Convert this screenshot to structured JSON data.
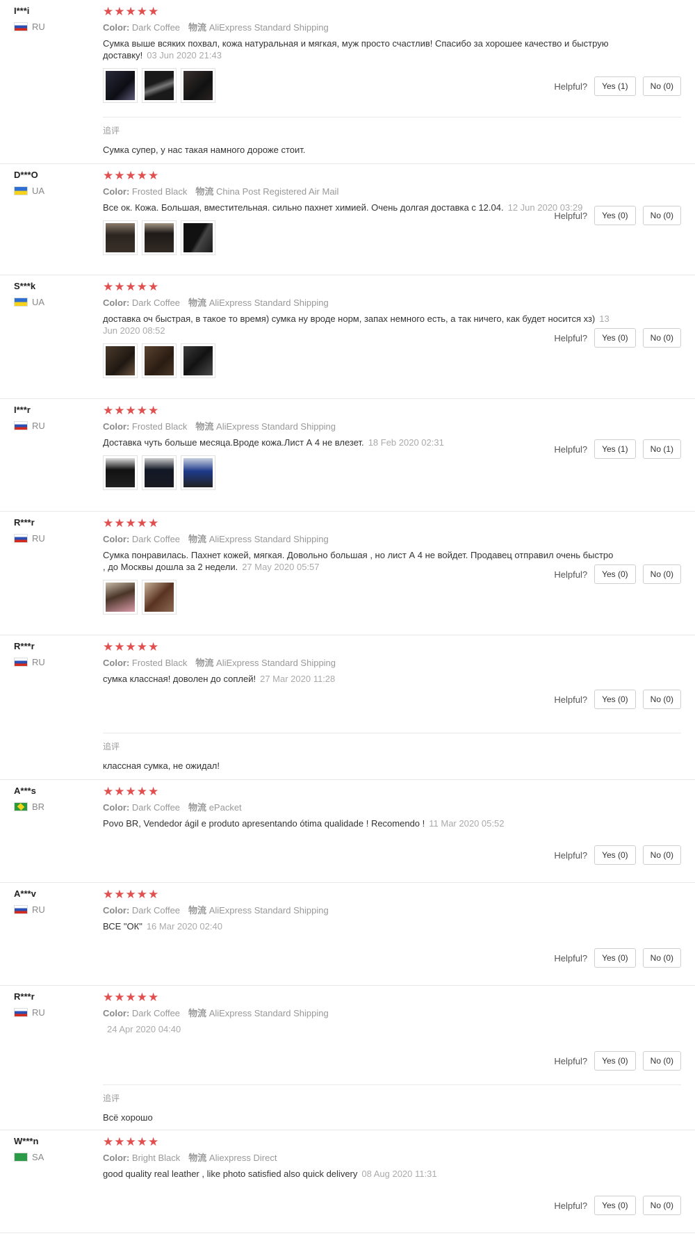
{
  "star_glyphs": "★★★★★",
  "color_label": "Color:",
  "shipping_label": "物流",
  "helpful_label": "Helpful?",
  "additional_label": "追评",
  "star_color": "#e24f4f",
  "reviews": [
    {
      "user": "I***i",
      "country": "RU",
      "rating": 5,
      "color": "Dark Coffee",
      "shipping": "AliExpress Standard Shipping",
      "text": "Сумка выше всяких похвал, кожа натуральная и мягкая, муж просто счастлив! Спасибо за хорошее качество и быструю доставку!",
      "date": "03 Jun 2020 21:43",
      "photos": 3,
      "yes": "Yes (1)",
      "no": "No (0)",
      "additional": "Сумка супер, у нас такая намного дороже стоит."
    },
    {
      "user": "D***O",
      "country": "UA",
      "rating": 5,
      "color": "Frosted Black",
      "shipping": "China Post Registered Air Mail",
      "text": "Все ок. Кожа. Большая, вместительная. сильно пахнет химией. Очень долгая доставка с 12.04.",
      "date": "12 Jun 2020 03:29",
      "photos": 3,
      "yes": "Yes (0)",
      "no": "No (0)"
    },
    {
      "user": "S***k",
      "country": "UA",
      "rating": 5,
      "color": "Dark Coffee",
      "shipping": "AliExpress Standard Shipping",
      "text": "доставка оч быстрая, в такое то время) сумка ну вроде норм, запах немного есть, а так ничего, как будет носится хз)",
      "date": "13 Jun 2020 08:52",
      "photos": 3,
      "yes": "Yes (0)",
      "no": "No (0)"
    },
    {
      "user": "I***r",
      "country": "RU",
      "rating": 5,
      "color": "Frosted Black",
      "shipping": "AliExpress Standard Shipping",
      "text": "Доставка чуть больше месяца.Вроде кожа.Лист А 4 не влезет.",
      "date": "18 Feb 2020 02:31",
      "photos": 3,
      "yes": "Yes (1)",
      "no": "No (1)"
    },
    {
      "user": "R***r",
      "country": "RU",
      "rating": 5,
      "color": "Dark Coffee",
      "shipping": "AliExpress Standard Shipping",
      "text": "Сумка понравилась. Пахнет кожей, мягкая. Довольно большая , но лист А 4 не войдет. Продавец отправил очень быстро , до Москвы дошла за 2 недели.",
      "date": "27 May 2020 05:57",
      "photos": 2,
      "yes": "Yes (0)",
      "no": "No (0)"
    },
    {
      "user": "R***r",
      "country": "RU",
      "rating": 5,
      "color": "Frosted Black",
      "shipping": "AliExpress Standard Shipping",
      "text": "сумка классная! доволен до соплей!",
      "date": "27 Mar 2020 11:28",
      "photos": 0,
      "yes": "Yes (0)",
      "no": "No (0)",
      "additional": "классная сумка, не ожидал!"
    },
    {
      "user": "A***s",
      "country": "BR",
      "rating": 5,
      "color": "Dark Coffee",
      "shipping": "ePacket",
      "text": "Povo BR, Vendedor ágil e produto apresentando ótima qualidade ! Recomendo !",
      "date": "11 Mar 2020 05:52",
      "photos": 0,
      "yes": "Yes (0)",
      "no": "No (0)"
    },
    {
      "user": "A***v",
      "country": "RU",
      "rating": 5,
      "color": "Dark Coffee",
      "shipping": "AliExpress Standard Shipping",
      "text": "ВСЕ \"ОК\"",
      "date": "16 Mar 2020 02:40",
      "photos": 0,
      "yes": "Yes (0)",
      "no": "No (0)"
    },
    {
      "user": "R***r",
      "country": "RU",
      "rating": 5,
      "color": "Dark Coffee",
      "shipping": "AliExpress Standard Shipping",
      "text": "",
      "date": "24 Apr 2020 04:40",
      "photos": 0,
      "yes": "Yes (0)",
      "no": "No (0)",
      "additional": "Всё хорошо"
    },
    {
      "user": "W***n",
      "country": "SA",
      "rating": 5,
      "color": "Bright Black",
      "shipping": "Aliexpress Direct",
      "text": "good quality real leather , like photo satisfied also quick delivery",
      "date": "08 Aug 2020 11:31",
      "photos": 0,
      "yes": "Yes (0)",
      "no": "No (0)"
    }
  ]
}
